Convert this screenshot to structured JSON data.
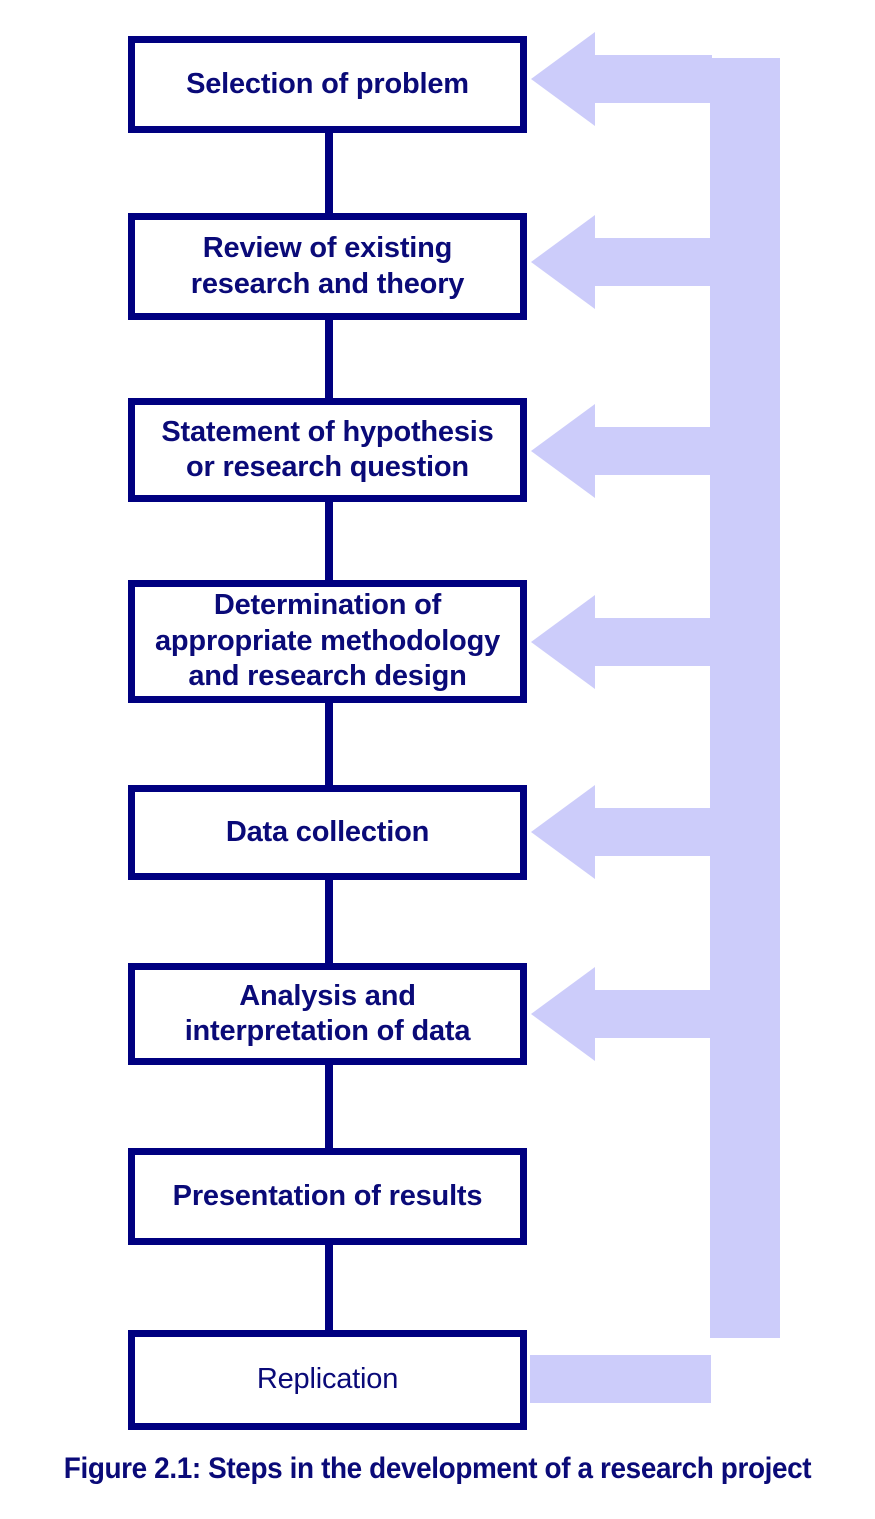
{
  "figure": {
    "caption": "Figure 2.1: Steps in the development of a research project",
    "colors": {
      "box_border": "#000080",
      "text": "#0A0A78",
      "arrow_fill": "#CCCCFA",
      "background": "#FFFFFF"
    }
  },
  "flow": {
    "title": "Steps in the development of a research project",
    "steps": [
      {
        "id": "selection-of-problem",
        "order": 1,
        "label": "Selection of problem",
        "lines": [
          "Selection of problem"
        ],
        "bold": true,
        "has_feedback_arrow": true
      },
      {
        "id": "review-of-research",
        "order": 2,
        "label": "Review of existing research and theory",
        "lines": [
          "Review of existing",
          "research and theory"
        ],
        "bold": true,
        "has_feedback_arrow": true
      },
      {
        "id": "statement-of-hypothesis",
        "order": 3,
        "label": "Statement of hypothesis or research question",
        "lines": [
          "Statement of hypothesis",
          "or research question"
        ],
        "bold": true,
        "has_feedback_arrow": true
      },
      {
        "id": "determination-of-method",
        "order": 4,
        "label": "Determination of appropriate methodology and research design",
        "lines": [
          "Determination of",
          "appropriate methodology",
          "and research design"
        ],
        "bold": true,
        "has_feedback_arrow": true
      },
      {
        "id": "data-collection",
        "order": 5,
        "label": "Data collection",
        "lines": [
          "Data collection"
        ],
        "bold": true,
        "has_feedback_arrow": true
      },
      {
        "id": "analysis-of-data",
        "order": 6,
        "label": "Analysis and interpretation of data",
        "lines": [
          "Analysis and",
          "interpretation of data"
        ],
        "bold": true,
        "has_feedback_arrow": true
      },
      {
        "id": "presentation-of-results",
        "order": 7,
        "label": "Presentation of results",
        "lines": [
          "Presentation of results"
        ],
        "bold": true,
        "has_feedback_arrow": false
      },
      {
        "id": "replication",
        "order": 8,
        "label": "Replication",
        "lines": [
          "Replication"
        ],
        "bold": false,
        "has_feedback_arrow": false
      }
    ],
    "feedback": {
      "description": "Replication feeds back to every earlier step",
      "source_step": "replication",
      "target_steps": [
        "selection-of-problem",
        "review-of-research",
        "statement-of-hypothesis",
        "determination-of-method",
        "data-collection",
        "analysis-of-data"
      ],
      "arrow_count": 6,
      "direction": "right-to-left"
    }
  }
}
